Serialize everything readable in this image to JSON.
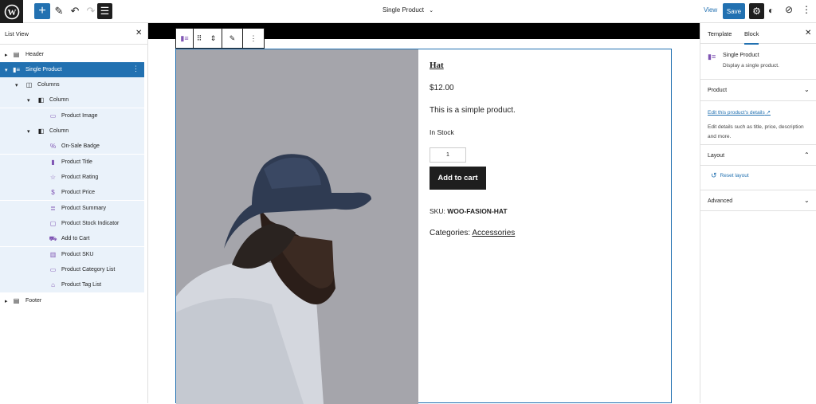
{
  "topbar": {
    "document_title": "Single Product",
    "view_label": "View",
    "save_label": "Save"
  },
  "list_view": {
    "title": "List View",
    "items": [
      {
        "label": "Header"
      },
      {
        "label": "Single Product"
      },
      {
        "label": "Columns"
      },
      {
        "label": "Column"
      },
      {
        "label": "Product Image"
      },
      {
        "label": "Column"
      },
      {
        "label": "On-Sale Badge"
      },
      {
        "label": "Product Title"
      },
      {
        "label": "Product Rating"
      },
      {
        "label": "Product Price"
      },
      {
        "label": "Product Summary"
      },
      {
        "label": "Product Stock Indicator"
      },
      {
        "label": "Add to Cart"
      },
      {
        "label": "Product SKU"
      },
      {
        "label": "Product Category List"
      },
      {
        "label": "Product Tag List"
      },
      {
        "label": "Footer"
      }
    ]
  },
  "product": {
    "title": "Hat",
    "price": "$12.00",
    "summary": "This is a simple product.",
    "stock": "In Stock",
    "quantity": "1",
    "add_to_cart": "Add to cart",
    "sku_label": "SKU:",
    "sku_value": "WOO-FASION-HAT",
    "categories_label": "Categories:",
    "category": "Accessories"
  },
  "inspector": {
    "tabs": [
      "Template",
      "Block"
    ],
    "active_tab": "Block",
    "block_name": "Single Product",
    "block_description": "Display a single product.",
    "panels": {
      "product": "Product",
      "layout": "Layout",
      "advanced": "Advanced"
    },
    "edit_link": "Edit this product's details",
    "edit_description": "Edit details such as title, price, description and more.",
    "reset_layout": "Reset layout"
  },
  "colors": {
    "accent": "#2271b1",
    "woo_purple": "#7f54b3",
    "dark": "#1e1e1e"
  }
}
